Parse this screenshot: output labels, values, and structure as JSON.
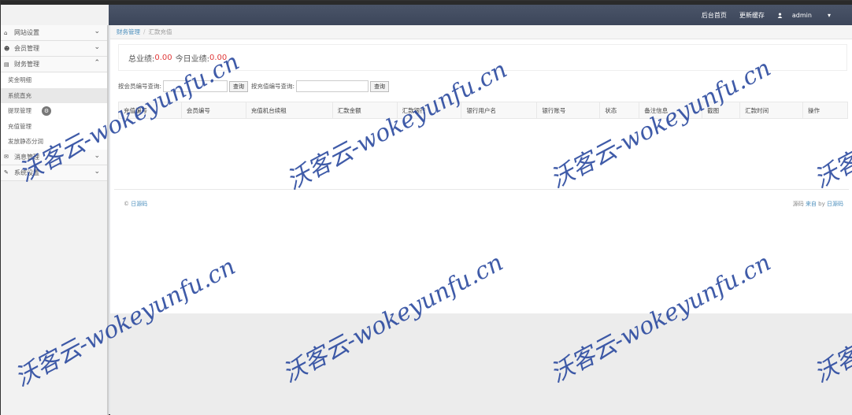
{
  "header": {
    "nav_home": "后台首页",
    "nav_cache": "更新缓存",
    "user_name": "admin",
    "user_icon": "user-icon",
    "caret": "▾"
  },
  "sidebar": {
    "groups": [
      {
        "label": "网站设置",
        "icon": "home-icon",
        "glyph": "⌂",
        "chevron": "⌄"
      },
      {
        "label": "会员管理",
        "icon": "users-icon",
        "glyph": "☻",
        "chevron": "⌄"
      },
      {
        "label": "财务管理",
        "icon": "wallet-icon",
        "glyph": "▤",
        "chevron": "⌃"
      },
      {
        "label": "消息管理",
        "icon": "envelope-icon",
        "glyph": "✉",
        "chevron": "⌄"
      },
      {
        "label": "系统设置",
        "icon": "edit-icon",
        "glyph": "✎",
        "chevron": "⌄"
      }
    ],
    "finance_items": [
      {
        "label": "奖金明细"
      },
      {
        "label": "系统直充"
      },
      {
        "label": "提现管理"
      },
      {
        "label": "充值管理"
      },
      {
        "label": "发放静态分润"
      }
    ],
    "badge_glyph": "⚙"
  },
  "breadcrumb": {
    "parent": "财务管理",
    "separator": "/",
    "current": "汇款充值"
  },
  "summary": {
    "total_label": "总业绩:",
    "total_value": "0.00",
    "today_label": "今日业绩:",
    "today_value": "0.00"
  },
  "search": {
    "member_label": "按会员编号查询:",
    "query1": "查询",
    "order_label": "按充值编号查询:",
    "query2": "查询"
  },
  "table": {
    "headers": [
      "充值编号",
      "会员编号",
      "充值机台续租",
      "汇款金额",
      "汇款银行",
      "银行用户名",
      "银行账号",
      "状态",
      "备注信息",
      "截图",
      "汇款时间",
      "操作"
    ]
  },
  "footer": {
    "copyright_symbol": "©",
    "left_link": "日源码",
    "right_prefix": "源码",
    "right_from": "来自",
    "right_by": "by",
    "right_link": "日源码"
  },
  "watermark": {
    "text": "沃客云-wokeyunfu.cn"
  }
}
